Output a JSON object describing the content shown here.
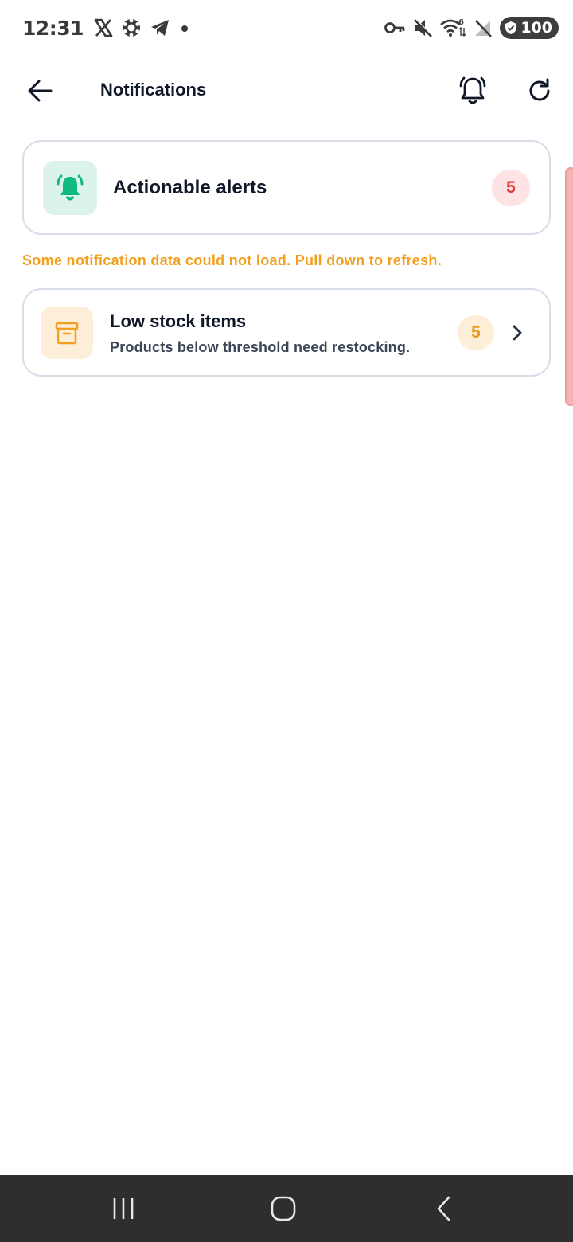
{
  "status_bar": {
    "time": "12:31",
    "left_icons": [
      "x-app-icon",
      "settings-app-icon",
      "telegram-icon",
      "dot-icon"
    ],
    "right_icons": [
      "vpn-key-icon",
      "mute-icon",
      "wifi-icon",
      "no-signal-icon"
    ],
    "wifi_label": "6",
    "battery": "100"
  },
  "app_bar": {
    "title": "Notifications"
  },
  "summary_card": {
    "title": "Actionable alerts",
    "count": "5",
    "icon": "bell-ringing-icon",
    "accent_color": "#10b981",
    "badge_color": "#e03a3a"
  },
  "warning": {
    "text": "Some notification data could not load. Pull down to refresh.",
    "color": "#f2a01e"
  },
  "items": [
    {
      "title": "Low stock items",
      "subtitle": "Products below threshold need restocking.",
      "count": "5",
      "icon": "archive-box-icon",
      "accent_color": "#f2a01e"
    }
  ],
  "nav_bar": {
    "buttons": [
      "recents-icon",
      "home-icon",
      "back-icon"
    ]
  }
}
